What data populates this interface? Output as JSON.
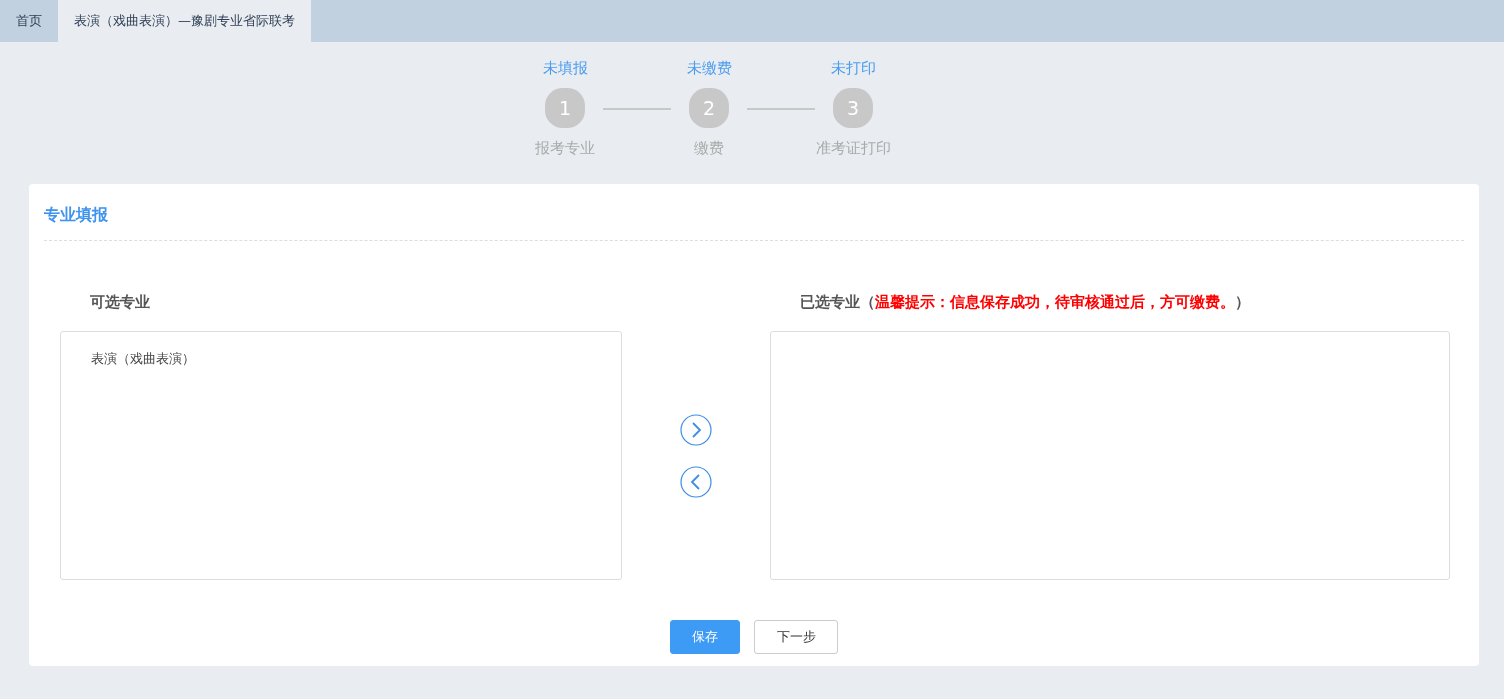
{
  "tabs": [
    {
      "label": "首页",
      "selected": false
    },
    {
      "label": "表演（戏曲表演）—豫剧专业省际联考",
      "selected": true
    }
  ],
  "steps": [
    {
      "status": "未填报",
      "number": "1",
      "label": "报考专业"
    },
    {
      "status": "未缴费",
      "number": "2",
      "label": "缴费"
    },
    {
      "status": "未打印",
      "number": "3",
      "label": "准考证打印"
    }
  ],
  "card": {
    "title": "专业填报",
    "available": {
      "heading": "可选专业",
      "items": [
        "表演（戏曲表演）"
      ]
    },
    "chosen": {
      "heading": "已选专业",
      "hint_open": "（",
      "hint": "温馨提示：信息保存成功，待审核通过后，方可缴费。",
      "hint_close": "）"
    },
    "buttons": [
      {
        "label": "保存",
        "kind": "primary"
      },
      {
        "label": "下一步",
        "kind": "default"
      }
    ]
  }
}
